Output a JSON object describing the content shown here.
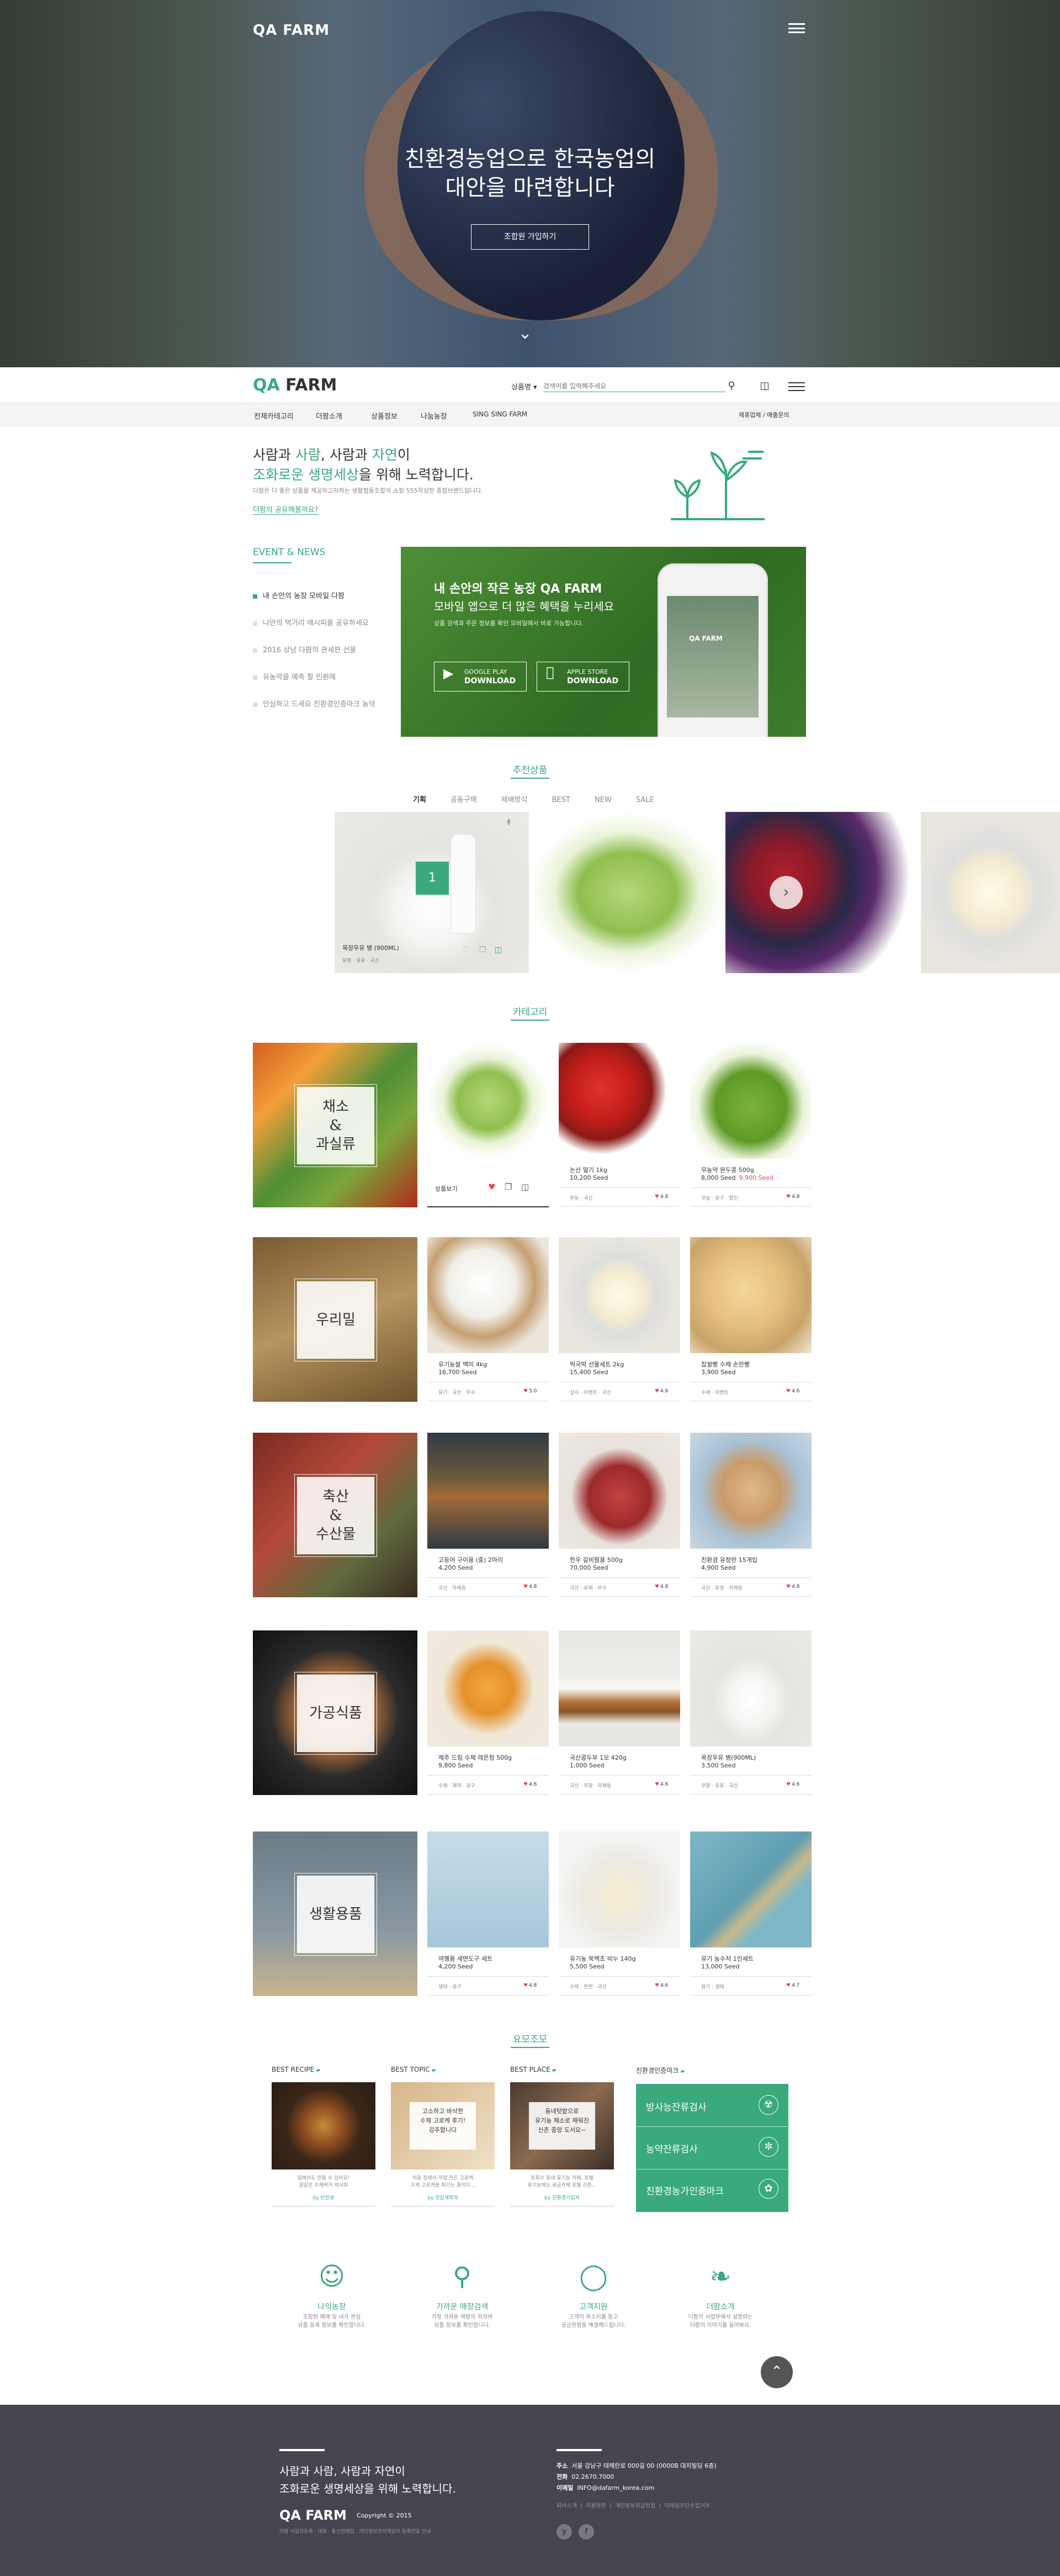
{
  "hero": {
    "logo": "QA FARM",
    "title_line1": "친환경농업으로 한국농업의",
    "title_line2": "대안을 마련합니다",
    "button": "조합원 가입하기"
  },
  "header": {
    "logo_q": "QA",
    "logo_rest": " FARM",
    "search_scope": "상품명 ▾",
    "search_placeholder": "검색어를 입력해주세요"
  },
  "menu": {
    "items": [
      "전체카테고리",
      "더팜소개",
      "상품정보",
      "나눔농장"
    ],
    "special": "SING SING FARM",
    "right": "제휴업체 / 매출문의"
  },
  "intro": {
    "line1_a": "사람과 ",
    "line1_b": "사람",
    "line1_c": ", 사람과 ",
    "line1_d": "자연",
    "line1_e": "이",
    "line2_a": "조화로운 생명세상",
    "line2_b": "을 위해 노력합니다.",
    "desc": "더팜은 더 좋은 상품을 제공하고자하는 생활협동조합의 쇼핑 555작성한 종합브랜드입니다.",
    "link": "더팜의 공유해볼까요?"
  },
  "events": {
    "title": "EVENT & NEWS",
    "items": [
      "내 손안의 농장 모바일 다팜",
      "나만의 먹거리 레시피를 공유하세요",
      "2016 상남 다팜의 관세판 선물",
      "유농악을 예측 할 민원에",
      "안심하고 드세요 친환경인증마크 농약"
    ]
  },
  "banner": {
    "title_a": "내 손안의 작은 농장 ",
    "title_b": "QA FARM",
    "subtitle": "모바일 앱으로 더 많은 혜택을 누리세요",
    "desc": "상품 검색과 주문 정보를 확인 모바일에서 바로 가능합니다.",
    "google_small": "GOOGLE PLAY",
    "google_big": "DOWNLOAD",
    "apple_small": "APPLE STORE",
    "apple_big": "DOWNLOAD",
    "phone_app": "QA FARM"
  },
  "recommend": {
    "title": "추천상품",
    "tabs": [
      "기획",
      "공동구매",
      "제배방식",
      "BEST",
      "NEW",
      "SALE"
    ],
    "badge": "1",
    "product_name": "목장우유 병 (900ML)",
    "product_meta": "유명 · 유유 · 국산"
  },
  "category": {
    "title": "카테고리",
    "rows": [
      {
        "label": "채소\n&\n과실류",
        "products": [
          {
            "name": "상품보기",
            "price": "",
            "sale": "",
            "meta": "",
            "rating": ""
          },
          {
            "name": "논산 딸기 1kg",
            "price": "10,200 Seed",
            "sale": "",
            "meta": "무농 · 국산",
            "rating": "4.8"
          },
          {
            "name": "무농약 완두콩 500g",
            "price": "8,000 Seed",
            "sale": "9,900 Seed",
            "meta": "무농 · 공구 · 할인",
            "rating": "4.8"
          }
        ]
      },
      {
        "label": "우리밀",
        "products": [
          {
            "name": "유기농쌀 백미 4kg",
            "price": "16,700 Seed",
            "sale": "",
            "meta": "유기 · 국산 · 무수",
            "rating": "5.0"
          },
          {
            "name": "떡국떡 선물세트 2kg",
            "price": "15,400 Seed",
            "sale": "",
            "meta": "상시 · 이벤트 · 국산",
            "rating": "4.6"
          },
          {
            "name": "찹쌀빵 수제 손만빵",
            "price": "3,900 Seed",
            "sale": "",
            "meta": "수제 · 이벤트",
            "rating": "4.6"
          }
        ]
      },
      {
        "label": "축산\n&\n수산물",
        "products": [
          {
            "name": "고등어 구이용 (중) 2마리",
            "price": "4,200 Seed",
            "sale": "",
            "meta": "국산 · 하체등",
            "rating": "4.8"
          },
          {
            "name": "한우 갈비찜용 500g",
            "price": "70,000 Seed",
            "sale": "",
            "meta": "국산 · 유제 · 무수",
            "rating": "4.8"
          },
          {
            "name": "친환경 유정란 15개입",
            "price": "4,900 Seed",
            "sale": "",
            "meta": "국산 · 유정 · 하체등",
            "rating": "4.8"
          }
        ]
      },
      {
        "label": "가공식품",
        "products": [
          {
            "name": "제주 드림 수제 레몬청 500g",
            "price": "9,800 Seed",
            "sale": "",
            "meta": "수제 · 제약 · 공구",
            "rating": "4.6"
          },
          {
            "name": "국산콩두부 1모 420g",
            "price": "1,000 Seed",
            "sale": "",
            "meta": "국산 · 무향 · 하체등",
            "rating": "4.6"
          },
          {
            "name": "목장우유 병(900ML)",
            "price": "3,500 Seed",
            "sale": "",
            "meta": "무향 · 유유 · 국산",
            "rating": "4.6"
          }
        ]
      },
      {
        "label": "생활용품",
        "products": [
          {
            "name": "여행용 세면도구 세트",
            "price": "4,200 Seed",
            "sale": "",
            "meta": "생태 · 공구",
            "rating": "4.8"
          },
          {
            "name": "유기농 쑥백초 비누 140g",
            "price": "5,500 Seed",
            "sale": "",
            "meta": "수제 · 천연 · 국산",
            "rating": "4.6"
          },
          {
            "name": "유기 농수저 1인세트",
            "price": "13,000 Seed",
            "sale": "",
            "meta": "유기 · 생태",
            "rating": "4.7"
          }
        ]
      }
    ]
  },
  "story": {
    "title": "요모조모",
    "cols": [
      {
        "head": "BEST RECIPE",
        "cap1": "집에서도 만들 수 있어요!",
        "cap2": "꿈같은 수제버거 레시피",
        "by": "by 민진경"
      },
      {
        "head": "BEST TOPIC",
        "img_text": "고소하고 바삭한\n수제 고로케 후기!\n강추합니다",
        "cap1": "처음 집에서 직접 만든 고로케",
        "cap2": "수제 고로케를 튀기는 중이다...",
        "by": "by 맛있게먹자"
      },
      {
        "head": "BEST PLACE",
        "img_text": "동네텃밭으로\n유기농 채소로 채워진\n신촌 중앙 도서요~",
        "cap1": "조회수 동네 유기농 카페, 호텔",
        "cap2": "유기농채소 공급카페 호텔 신촌...",
        "by": "by 친환경가입자"
      },
      {
        "head": "친환경인증마크",
        "rows": [
          "방사능잔류검사",
          "농약잔류검사",
          "친환경농가인증마크"
        ]
      }
    ]
  },
  "services": [
    {
      "icon": "user-icon",
      "title": "나의농장",
      "desc1": "조합원 예매 및 내가 관심",
      "desc2": "상품 등록 정보를 확인합니다."
    },
    {
      "icon": "pin-icon",
      "title": "가까운 매장검색",
      "desc1": "가장 가까운 매장의 위치와",
      "desc2": "상품 정보를 확인합니다."
    },
    {
      "icon": "bulb-icon",
      "title": "고객지원",
      "desc1": "고객의 목소리를 듣고",
      "desc2": "궁금한점을 해결해드립니다."
    },
    {
      "icon": "leaf-icon",
      "title": "더팜소개",
      "desc1": "더팜의 사업부에서 설명하는",
      "desc2": "더팜의 이야기를 들어봐요."
    }
  ],
  "footer": {
    "title_line1": "사람과 사람, 사람과 자연이",
    "title_line2": "조화로운 생명세상을 위해 노력합니다.",
    "logo": "QA FARM",
    "copyright": "Copyright © 2015",
    "small": "더팜 사업자등록 · 대표 · 통신판매업 · 개인정보관리책임자 등록번호 안내",
    "info": [
      {
        "k": "주소",
        "v": "서울 강남구 테헤란로 000길 00 (0000B 대치빌딩 6층)"
      },
      {
        "k": "전화",
        "v": "02.2670.7000"
      },
      {
        "k": "이메일",
        "v": "INFO@dafarm_korea.com"
      }
    ],
    "links": [
      "회사소개",
      "이용약관",
      "개인정보취급방침",
      "이메일무단수집거부"
    ],
    "social": [
      "y",
      "f"
    ]
  },
  "colors": {
    "accent": "#3aaa7c",
    "footer": "#48444f",
    "sale": "#e24b4b"
  }
}
